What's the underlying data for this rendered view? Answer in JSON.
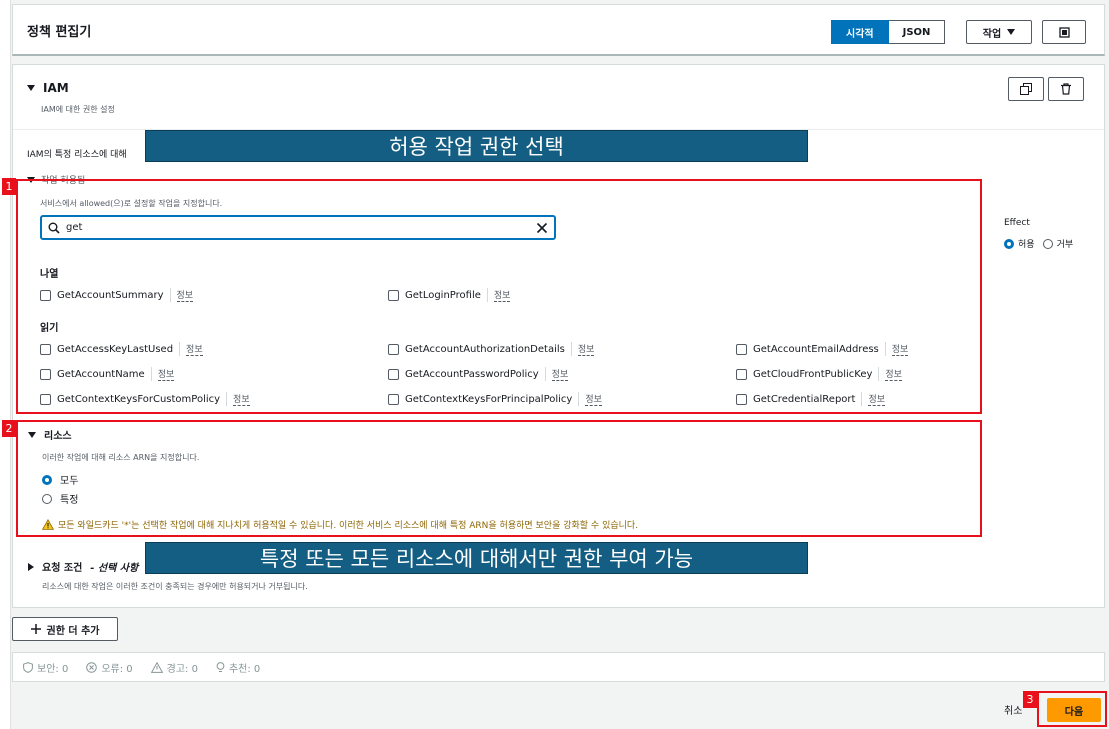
{
  "header": {
    "title": "정책 편집기",
    "seg_visual": "시각적",
    "seg_json": "JSON",
    "actions_label": "작업"
  },
  "iam": {
    "title": "IAM",
    "subtitle": "IAM에 대한 권한 설정",
    "resource_desc": "IAM의 특정 리소스에 대해",
    "actions_head": "작업 허용됨",
    "actions_desc": "서비스에서 allowed(으)로 설정할 작업을 지정합니다.",
    "search_value": "get",
    "info_label": "정보",
    "sections": [
      {
        "label": "나열",
        "items": [
          "GetAccountSummary",
          "GetLoginProfile"
        ]
      },
      {
        "label": "읽기",
        "items": [
          "GetAccessKeyLastUsed",
          "GetAccountAuthorizationDetails",
          "GetAccountEmailAddress",
          "GetAccountName",
          "GetAccountPasswordPolicy",
          "GetCloudFrontPublicKey",
          "GetContextKeysForCustomPolicy",
          "GetContextKeysForPrincipalPolicy",
          "GetCredentialReport"
        ]
      }
    ],
    "effect": {
      "label": "Effect",
      "allow": "허용",
      "deny": "거부",
      "selected": "허용"
    },
    "resources": {
      "title": "리소스",
      "desc": "이러한 작업에 대해 리소스 ARN을 지정합니다.",
      "opt_all": "모두",
      "opt_specific": "특정",
      "selected": "모두",
      "warning": "모든 와일드카드 '*'는 선택한 작업에 대해 지나치게 허용적일 수 있습니다. 이러한 서비스 리소스에 대해 특정 ARN을 허용하면 보안을 강화할 수 있습니다."
    },
    "conditions": {
      "title": "요청 조건",
      "title_note": "- 선택 사항",
      "desc": "리소스에 대한 작업은 이러한 조건이 충족되는 경우에만 허용되거나 거부됩니다."
    }
  },
  "add_permission": "권한 더 추가",
  "status": {
    "security": "보안: 0",
    "errors": "오류: 0",
    "warnings": "경고: 0",
    "suggestions": "추천: 0"
  },
  "footer": {
    "cancel": "취소",
    "next": "다음"
  },
  "annotations": {
    "banner_top": "허용 작업 권한 선택",
    "banner_bottom": "특정 또는 모든 리소스에 대해서만 권한 부여 가능",
    "marker_1": "1",
    "marker_2": "2",
    "marker_3": "3",
    "highlight_color": "#e8111b",
    "banner_color": "#135e82"
  }
}
